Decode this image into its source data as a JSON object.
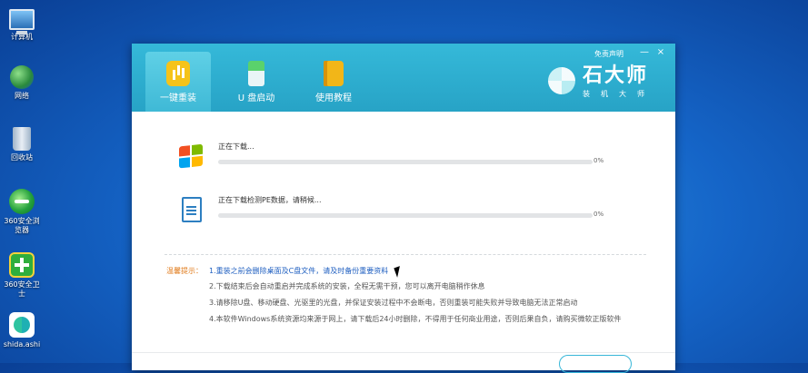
{
  "desktop": {
    "icons": [
      {
        "label": "计算机"
      },
      {
        "label": "网络"
      },
      {
        "label": "回收站"
      },
      {
        "label": "360安全浏览器"
      },
      {
        "label": "360安全卫士"
      },
      {
        "label": "shida.ashi"
      }
    ]
  },
  "window": {
    "disclaimer": "免责声明",
    "tabs": [
      {
        "label": "一键重装"
      },
      {
        "label": "U 盘启动"
      },
      {
        "label": "使用教程"
      }
    ],
    "logo": {
      "name": "石大师",
      "sub": "装机大师"
    },
    "tasks": [
      {
        "label": "正在下载...",
        "percent": "0%",
        "progress": 0
      },
      {
        "label": "正在下载检测PE数据，请稍候...",
        "percent": "0%",
        "progress": 0
      }
    ],
    "tips_title": "温馨提示：",
    "tips": [
      "1.重装之前会删除桌面及C盘文件，请及时备份重要资料",
      "2.下载结束后会自动重启并完成系统的安装，全程无需干预，您可以离开电脑稍作休息",
      "3.请移除U盘、移动硬盘、光驱里的光盘，并保证安装过程中不会断电，否则重装可能失败并导致电脑无法正常启动",
      "4.本软件Windows系统资源均来源于网上，请下载后24小时删除，不得用于任何商业用途，否则后果自负，请购买微软正版软件"
    ],
    "window_controls": {
      "minimize": "—",
      "close": "×"
    }
  },
  "colors": {
    "header": "#2aa9cb",
    "tip_highlight": "#1f5fc0",
    "tip_title": "#e07a1a"
  }
}
